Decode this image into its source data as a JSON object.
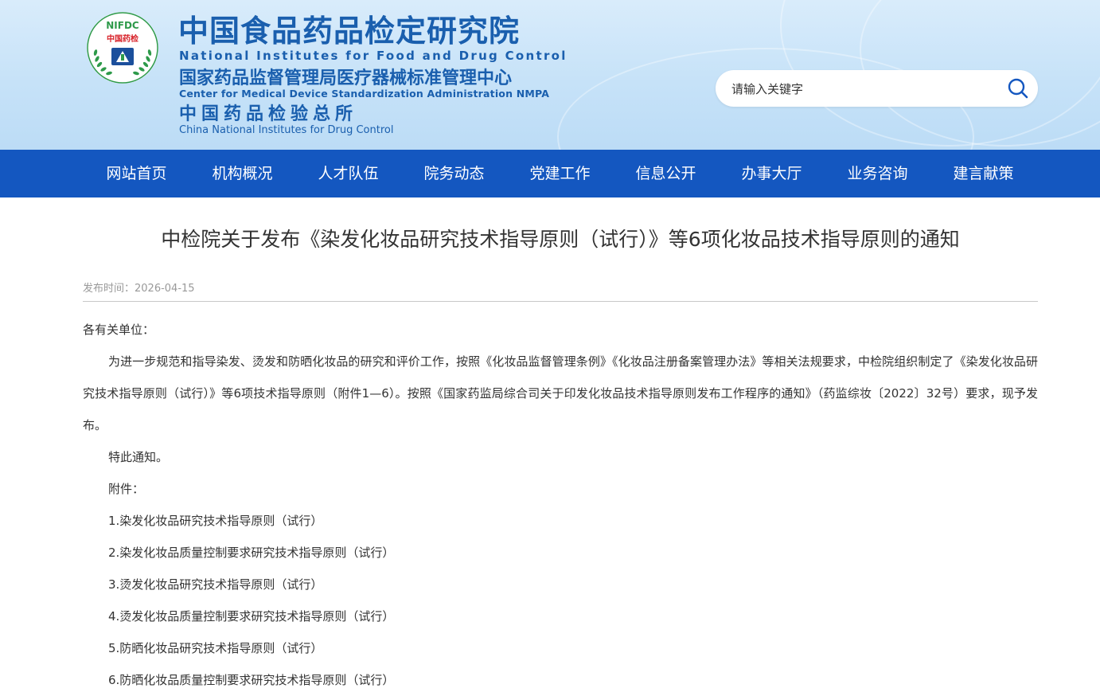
{
  "header": {
    "logo": {
      "ring_text": "NIFDC",
      "badge_text": "中国药检"
    },
    "title_cn": "中国食品药品检定研究院",
    "title_en": "National Institutes for Food and Drug Control",
    "sub1_cn": "国家药品监督管理局医疗器械标准管理中心",
    "sub1_en": "Center for Medical Device Standardization Administration NMPA",
    "sub2_cn": "中国药品检验总所",
    "sub2_en": "China National Institutes for Drug Control",
    "brand_color": "#1a5fae"
  },
  "search": {
    "placeholder": "请输入关键字",
    "icon": "search-icon"
  },
  "nav": {
    "background": "#1457c0",
    "items": [
      {
        "label": "网站首页"
      },
      {
        "label": "机构概况"
      },
      {
        "label": "人才队伍"
      },
      {
        "label": "院务动态"
      },
      {
        "label": "党建工作"
      },
      {
        "label": "信息公开"
      },
      {
        "label": "办事大厅"
      },
      {
        "label": "业务咨询"
      },
      {
        "label": "建言献策"
      }
    ]
  },
  "article": {
    "title": "中检院关于发布《染发化妆品研究技术指导原则（试行）》等6项化妆品技术指导原则的通知",
    "published_label": "发布时间：",
    "published_date": "2026-04-15",
    "greeting": "各有关单位：",
    "body": "为进一步规范和指导染发、烫发和防晒化妆品的研究和评价工作，按照《化妆品监督管理条例》《化妆品注册备案管理办法》等相关法规要求，中检院组织制定了《染发化妆品研究技术指导原则（试行）》等6项技术指导原则（附件1—6）。按照《国家药监局综合司关于印发化妆品技术指导原则发布工作程序的通知》（药监综妆〔2022〕32号）要求，现予发布。",
    "notice": "特此通知。",
    "attachments_label": "附件：",
    "attachments": [
      "1.染发化妆品研究技术指导原则（试行）",
      "2.染发化妆品质量控制要求研究技术指导原则（试行）",
      "3.烫发化妆品研究技术指导原则（试行）",
      "4.烫发化妆品质量控制要求研究技术指导原则（试行）",
      "5.防晒化妆品研究技术指导原则（试行）",
      "6.防晒化妆品质量控制要求研究技术指导原则（试行）"
    ]
  }
}
